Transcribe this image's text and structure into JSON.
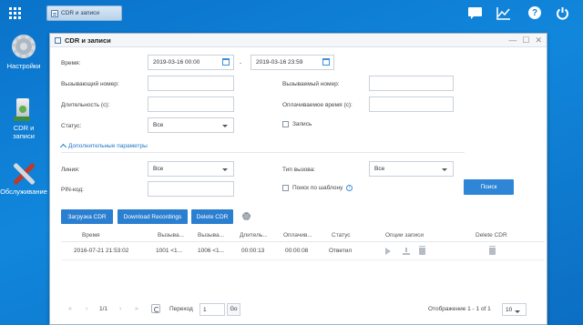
{
  "taskbar": {
    "tab_label": "CDR и записи"
  },
  "desktop": {
    "settings_label": "Настройки",
    "cdr_label": "CDR и записи",
    "service_label": "Обслуживание"
  },
  "window": {
    "title": "CDR и записи"
  },
  "filters": {
    "time_label": "Время:",
    "time_from": "2019-03-16 00:00",
    "time_sep": "-",
    "time_to": "2019-03-16 23:59",
    "caller_label": "Вызывающий номер:",
    "callee_label": "Вызываемый номер:",
    "duration_label": "Длительность (с):",
    "billable_label": "Оплачиваемое время (с):",
    "status_label": "Статус:",
    "status_value": "Все",
    "record_label": "Запись",
    "advanced_label": "Дополнительные параметры",
    "line_label": "Линия:",
    "line_value": "Все",
    "call_type_label": "Тип вызова:",
    "call_type_value": "Все",
    "pin_label": "PIN-код:",
    "pattern_label": "Поиск по шаблону",
    "search_button": "Поиск"
  },
  "actions": {
    "upload_cdr": "Загрузка CDR",
    "download_recordings": "Download Recordings",
    "delete_cdr": "Delete CDR"
  },
  "table": {
    "headers": [
      "Время",
      "Вызыва...",
      "Вызыва...",
      "Длитель...",
      "Оплачив...",
      "Статус",
      "Опции записи",
      "Delete CDR"
    ],
    "rows": [
      {
        "time": "2016-07-21 21:53:02",
        "caller": "1001 <1...",
        "callee": "1006 <1...",
        "duration": "00:00:13",
        "billable": "00:00:08",
        "status": "Ответил"
      }
    ]
  },
  "pager": {
    "first": "«",
    "prev": "‹",
    "page_info": "1/1",
    "next": "›",
    "last": "»",
    "goto_label": "Переход",
    "goto_value": "1",
    "go_button": "Go",
    "display_info": "Отображение 1 - 1 of 1",
    "page_size": "10"
  }
}
